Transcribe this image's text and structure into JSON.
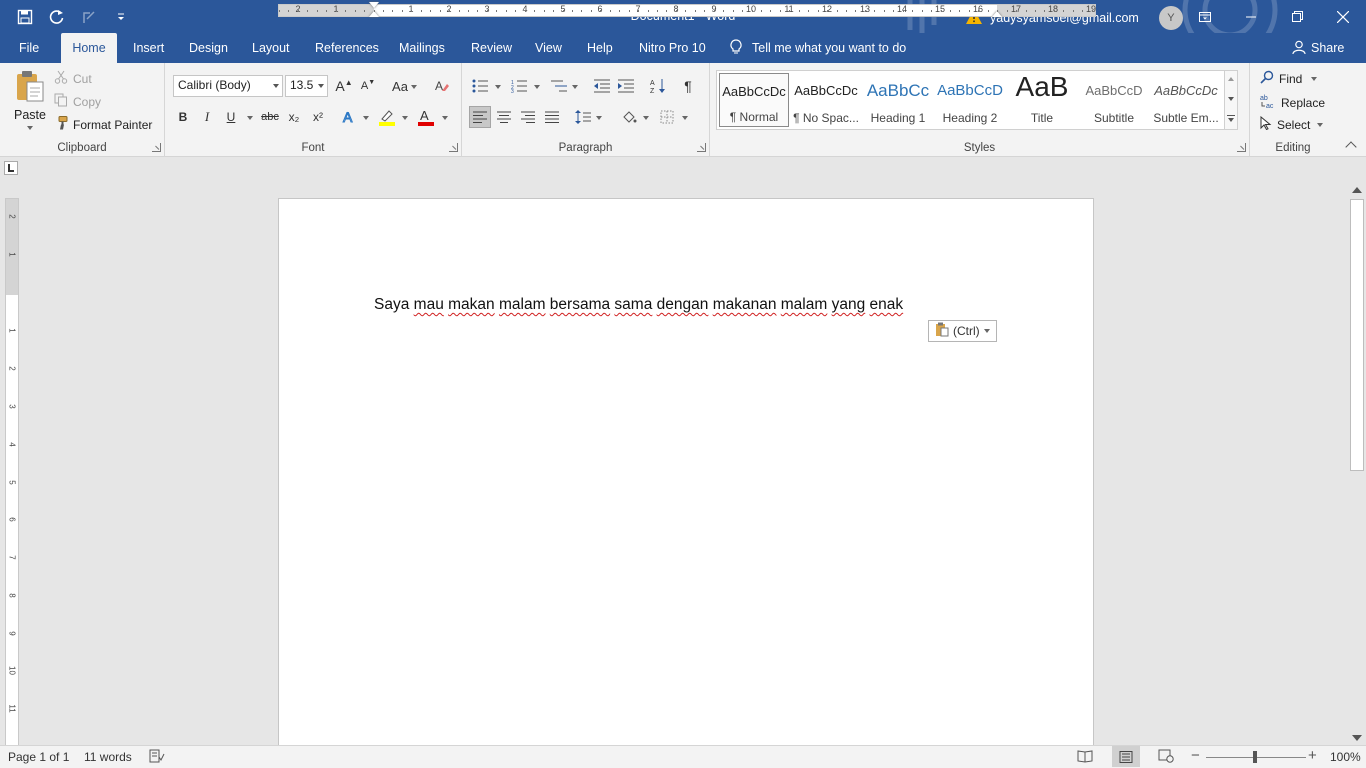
{
  "window": {
    "title": "Document1 - Word",
    "account_email": "yadysyamsoel@gmail.com",
    "avatar_initial": "Y"
  },
  "tabs": [
    "File",
    "Home",
    "Insert",
    "Design",
    "Layout",
    "References",
    "Mailings",
    "Review",
    "View",
    "Help",
    "Nitro Pro 10"
  ],
  "active_tab": "Home",
  "tell_me": "Tell me what you want to do",
  "share": "Share",
  "clipboard": {
    "label": "Clipboard",
    "paste": "Paste",
    "cut": "Cut",
    "copy": "Copy",
    "format_painter": "Format Painter"
  },
  "font": {
    "label": "Font",
    "font_name": "Calibri (Body)",
    "font_size": "13.5",
    "change_case": "Aa",
    "bold": "B",
    "italic": "I",
    "underline": "U",
    "strike": "abc",
    "subscript": "x₂",
    "superscript": "x²"
  },
  "paragraph": {
    "label": "Paragraph"
  },
  "styles": {
    "label": "Styles",
    "items": [
      {
        "preview": "AaBbCcDc",
        "name": "¶ Normal"
      },
      {
        "preview": "AaBbCcDc",
        "name": "¶ No Spac..."
      },
      {
        "preview": "AaBbCc",
        "name": "Heading 1"
      },
      {
        "preview": "AaBbCcD",
        "name": "Heading 2"
      },
      {
        "preview": "AaB",
        "name": "Title"
      },
      {
        "preview": "AaBbCcD",
        "name": "Subtitle"
      },
      {
        "preview": "AaBbCcDc",
        "name": "Subtle Em..."
      }
    ]
  },
  "editing": {
    "label": "Editing",
    "find": "Find",
    "replace": "Replace",
    "select": "Select"
  },
  "ruler": {
    "labels": [
      "2",
      "1",
      "1",
      "2",
      "3",
      "4",
      "5",
      "6",
      "7",
      "8",
      "9",
      "10",
      "11",
      "12",
      "13",
      "14",
      "15",
      "16",
      "17",
      "18",
      "19"
    ],
    "v_labels": [
      "2",
      "1",
      "1",
      "2",
      "3",
      "4",
      "5",
      "6",
      "7",
      "8",
      "9",
      "10",
      "11"
    ]
  },
  "document": {
    "words": [
      "Saya",
      "mau",
      "makan",
      "malam",
      "bersama",
      "sama",
      "dengan",
      "makanan",
      "malam",
      "yang",
      "enak"
    ],
    "misspelled": [
      false,
      true,
      true,
      true,
      true,
      true,
      true,
      true,
      true,
      true,
      true
    ],
    "paste_options": "(Ctrl)"
  },
  "status": {
    "page": "Page 1 of 1",
    "words": "11 words",
    "zoom": "100%"
  },
  "colors": {
    "title_bar": "#2b579a",
    "ribbon": "#f3f3f3",
    "highlight": "#ffff00",
    "font_color": "#e00000"
  }
}
